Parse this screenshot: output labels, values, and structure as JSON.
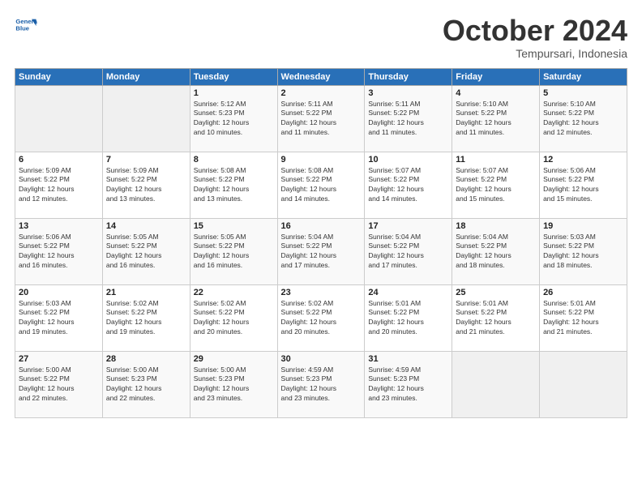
{
  "header": {
    "logo_line1": "General",
    "logo_line2": "Blue",
    "month": "October 2024",
    "location": "Tempursari, Indonesia"
  },
  "weekdays": [
    "Sunday",
    "Monday",
    "Tuesday",
    "Wednesday",
    "Thursday",
    "Friday",
    "Saturday"
  ],
  "weeks": [
    [
      {
        "day": "",
        "info": ""
      },
      {
        "day": "",
        "info": ""
      },
      {
        "day": "1",
        "info": "Sunrise: 5:12 AM\nSunset: 5:23 PM\nDaylight: 12 hours\nand 10 minutes."
      },
      {
        "day": "2",
        "info": "Sunrise: 5:11 AM\nSunset: 5:22 PM\nDaylight: 12 hours\nand 11 minutes."
      },
      {
        "day": "3",
        "info": "Sunrise: 5:11 AM\nSunset: 5:22 PM\nDaylight: 12 hours\nand 11 minutes."
      },
      {
        "day": "4",
        "info": "Sunrise: 5:10 AM\nSunset: 5:22 PM\nDaylight: 12 hours\nand 11 minutes."
      },
      {
        "day": "5",
        "info": "Sunrise: 5:10 AM\nSunset: 5:22 PM\nDaylight: 12 hours\nand 12 minutes."
      }
    ],
    [
      {
        "day": "6",
        "info": "Sunrise: 5:09 AM\nSunset: 5:22 PM\nDaylight: 12 hours\nand 12 minutes."
      },
      {
        "day": "7",
        "info": "Sunrise: 5:09 AM\nSunset: 5:22 PM\nDaylight: 12 hours\nand 13 minutes."
      },
      {
        "day": "8",
        "info": "Sunrise: 5:08 AM\nSunset: 5:22 PM\nDaylight: 12 hours\nand 13 minutes."
      },
      {
        "day": "9",
        "info": "Sunrise: 5:08 AM\nSunset: 5:22 PM\nDaylight: 12 hours\nand 14 minutes."
      },
      {
        "day": "10",
        "info": "Sunrise: 5:07 AM\nSunset: 5:22 PM\nDaylight: 12 hours\nand 14 minutes."
      },
      {
        "day": "11",
        "info": "Sunrise: 5:07 AM\nSunset: 5:22 PM\nDaylight: 12 hours\nand 15 minutes."
      },
      {
        "day": "12",
        "info": "Sunrise: 5:06 AM\nSunset: 5:22 PM\nDaylight: 12 hours\nand 15 minutes."
      }
    ],
    [
      {
        "day": "13",
        "info": "Sunrise: 5:06 AM\nSunset: 5:22 PM\nDaylight: 12 hours\nand 16 minutes."
      },
      {
        "day": "14",
        "info": "Sunrise: 5:05 AM\nSunset: 5:22 PM\nDaylight: 12 hours\nand 16 minutes."
      },
      {
        "day": "15",
        "info": "Sunrise: 5:05 AM\nSunset: 5:22 PM\nDaylight: 12 hours\nand 16 minutes."
      },
      {
        "day": "16",
        "info": "Sunrise: 5:04 AM\nSunset: 5:22 PM\nDaylight: 12 hours\nand 17 minutes."
      },
      {
        "day": "17",
        "info": "Sunrise: 5:04 AM\nSunset: 5:22 PM\nDaylight: 12 hours\nand 17 minutes."
      },
      {
        "day": "18",
        "info": "Sunrise: 5:04 AM\nSunset: 5:22 PM\nDaylight: 12 hours\nand 18 minutes."
      },
      {
        "day": "19",
        "info": "Sunrise: 5:03 AM\nSunset: 5:22 PM\nDaylight: 12 hours\nand 18 minutes."
      }
    ],
    [
      {
        "day": "20",
        "info": "Sunrise: 5:03 AM\nSunset: 5:22 PM\nDaylight: 12 hours\nand 19 minutes."
      },
      {
        "day": "21",
        "info": "Sunrise: 5:02 AM\nSunset: 5:22 PM\nDaylight: 12 hours\nand 19 minutes."
      },
      {
        "day": "22",
        "info": "Sunrise: 5:02 AM\nSunset: 5:22 PM\nDaylight: 12 hours\nand 20 minutes."
      },
      {
        "day": "23",
        "info": "Sunrise: 5:02 AM\nSunset: 5:22 PM\nDaylight: 12 hours\nand 20 minutes."
      },
      {
        "day": "24",
        "info": "Sunrise: 5:01 AM\nSunset: 5:22 PM\nDaylight: 12 hours\nand 20 minutes."
      },
      {
        "day": "25",
        "info": "Sunrise: 5:01 AM\nSunset: 5:22 PM\nDaylight: 12 hours\nand 21 minutes."
      },
      {
        "day": "26",
        "info": "Sunrise: 5:01 AM\nSunset: 5:22 PM\nDaylight: 12 hours\nand 21 minutes."
      }
    ],
    [
      {
        "day": "27",
        "info": "Sunrise: 5:00 AM\nSunset: 5:22 PM\nDaylight: 12 hours\nand 22 minutes."
      },
      {
        "day": "28",
        "info": "Sunrise: 5:00 AM\nSunset: 5:23 PM\nDaylight: 12 hours\nand 22 minutes."
      },
      {
        "day": "29",
        "info": "Sunrise: 5:00 AM\nSunset: 5:23 PM\nDaylight: 12 hours\nand 23 minutes."
      },
      {
        "day": "30",
        "info": "Sunrise: 4:59 AM\nSunset: 5:23 PM\nDaylight: 12 hours\nand 23 minutes."
      },
      {
        "day": "31",
        "info": "Sunrise: 4:59 AM\nSunset: 5:23 PM\nDaylight: 12 hours\nand 23 minutes."
      },
      {
        "day": "",
        "info": ""
      },
      {
        "day": "",
        "info": ""
      }
    ]
  ]
}
